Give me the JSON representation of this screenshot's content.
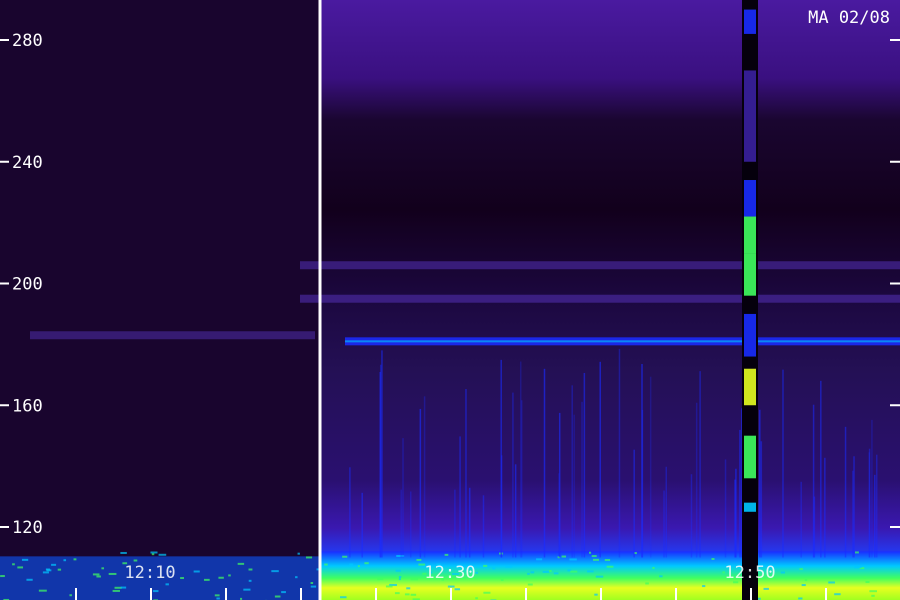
{
  "chart_data": {
    "type": "heatmap",
    "title": "MA 02/08",
    "y_ticks": [
      120,
      160,
      200,
      240,
      280
    ],
    "y_range": [
      103,
      299
    ],
    "x_ticks": [
      "12:10",
      "12:30",
      "12:50"
    ],
    "x_tick_positions_min": [
      10,
      30,
      50
    ],
    "x_range_min": [
      2,
      61
    ],
    "data_gap_at_min": 21.3,
    "colors": {
      "background": "#14001f",
      "noise_floor": "#2a0a5a",
      "band_blue": "#1a2cff",
      "band_cyan": "#00c8ff",
      "band_green": "#40ff60",
      "band_yellow": "#e8ff20",
      "marker": "#ffffff"
    },
    "features": [
      {
        "kind": "horizontal_band",
        "freq": 181,
        "from_min": 23,
        "to_min": 61,
        "level": 0.75
      },
      {
        "kind": "horizontal_band",
        "freq": 195,
        "from_min": 20,
        "to_min": 61,
        "level": 0.35
      },
      {
        "kind": "horizontal_band",
        "freq": 206,
        "from_min": 20,
        "to_min": 61,
        "level": 0.3
      },
      {
        "kind": "horizontal_band",
        "freq": 183,
        "from_min": 2,
        "to_min": 21,
        "level": 0.2
      },
      {
        "kind": "vertical_burst",
        "at_min": 50.0,
        "from_freq": 103,
        "to_freq": 290,
        "level": 0.95
      },
      {
        "kind": "low_freq_noise",
        "from_freq": 103,
        "to_freq": 112,
        "level": 0.85
      }
    ]
  }
}
